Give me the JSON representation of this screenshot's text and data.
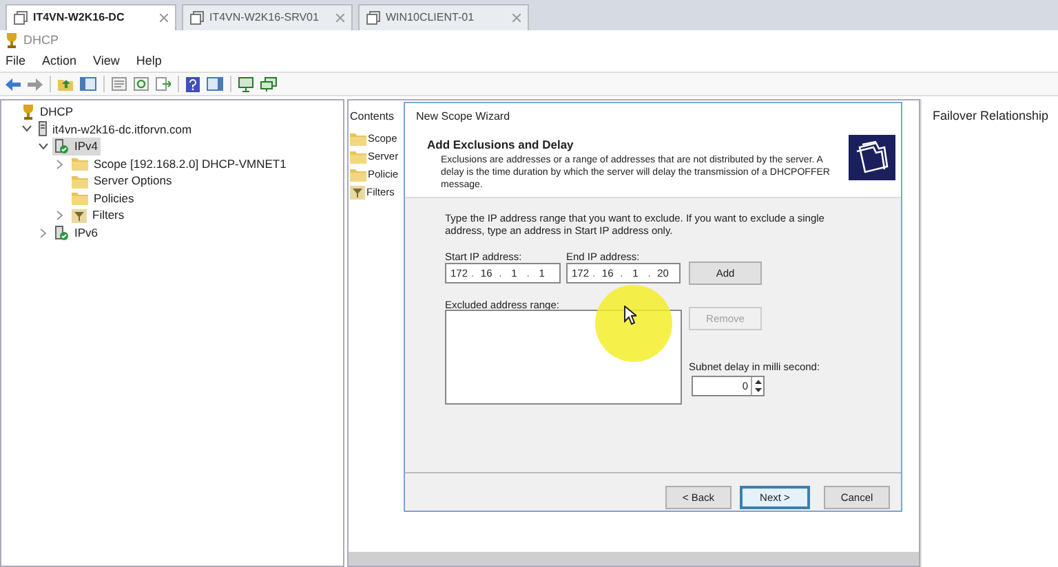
{
  "tabs": [
    {
      "label": "IT4VN-W2K16-DC",
      "selected": true
    },
    {
      "label": "IT4VN-W2K16-SRV01",
      "selected": false
    },
    {
      "label": "WIN10CLIENT-01",
      "selected": false
    }
  ],
  "window": {
    "title": "DHCP"
  },
  "menu": [
    "File",
    "Action",
    "View",
    "Help"
  ],
  "tree": [
    {
      "label": "DHCP",
      "kind": "root",
      "selected": false,
      "children": [
        {
          "label": "it4vn-w2k16-dc.itforvn.com",
          "kind": "server",
          "selected": false,
          "expanded": true,
          "children": [
            {
              "label": "IPv4",
              "kind": "protocol",
              "selected": true,
              "expanded": true,
              "children": [
                {
                  "label": "Scope [192.168.2.0] DHCP-VMNET1",
                  "kind": "folder",
                  "selected": false,
                  "expanded": false
                },
                {
                  "label": "Server Options",
                  "kind": "folder",
                  "selected": false
                },
                {
                  "label": "Policies",
                  "kind": "folder",
                  "selected": false
                },
                {
                  "label": "Filters",
                  "kind": "filter",
                  "selected": false,
                  "expanded": false
                }
              ]
            },
            {
              "label": "IPv6",
              "kind": "protocol",
              "selected": false,
              "expanded": false
            }
          ]
        }
      ]
    }
  ],
  "contents": {
    "header": "Contents",
    "items": [
      {
        "label": "Scope",
        "kind": "folder"
      },
      {
        "label": "Server",
        "kind": "folder"
      },
      {
        "label": "Policie",
        "kind": "folder"
      },
      {
        "label": "Filters",
        "kind": "filter"
      }
    ]
  },
  "right_panel": {
    "header": "Failover Relationship"
  },
  "wizard": {
    "title": "New Scope Wizard",
    "heading": "Add Exclusions and Delay",
    "description": "Exclusions are addresses or a range of addresses that are not distributed by the server. A delay is the time duration by which the server will delay the transmission of a DHCPOFFER message.",
    "instructions": "Type the IP address range that you want to exclude. If you want to exclude a single address, type an address in Start IP address only.",
    "start_ip": {
      "label": "Start IP address:",
      "separator": ".",
      "octets": [
        "172",
        "16",
        "1",
        "1"
      ]
    },
    "end_ip": {
      "label": "End IP address:",
      "separator": ".",
      "octets": [
        "172",
        "16",
        "1",
        "20"
      ]
    },
    "add_button": {
      "label": "Add",
      "disabled": false
    },
    "excluded_label": "Excluded address range:",
    "remove_button": {
      "label": "Remove",
      "disabled": true
    },
    "delay": {
      "label": "Subnet delay in milli second:",
      "value": "0"
    },
    "buttons": [
      {
        "label": "< Back",
        "default": false
      },
      {
        "label": "Next >",
        "default": true
      },
      {
        "label": "Cancel",
        "default": false
      }
    ]
  }
}
